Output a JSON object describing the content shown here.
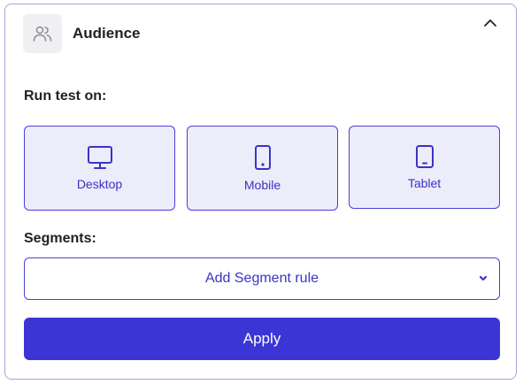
{
  "header": {
    "title": "Audience",
    "avatar_icon": "users-icon",
    "collapse_icon": "chevron-up-icon"
  },
  "run_test": {
    "label": "Run test on:",
    "devices": [
      {
        "label": "Desktop",
        "icon": "monitor-icon"
      },
      {
        "label": "Mobile",
        "icon": "smartphone-icon"
      },
      {
        "label": "Tablet",
        "icon": "tablet-icon"
      }
    ]
  },
  "segments": {
    "label": "Segments:",
    "select_text": "Add Segment rule",
    "dropdown_icon": "chevron-down-icon"
  },
  "apply_label": "Apply",
  "colors": {
    "accent": "#3b35d6",
    "card_bg": "#ececfb",
    "panel_border": "#b39bd9"
  }
}
